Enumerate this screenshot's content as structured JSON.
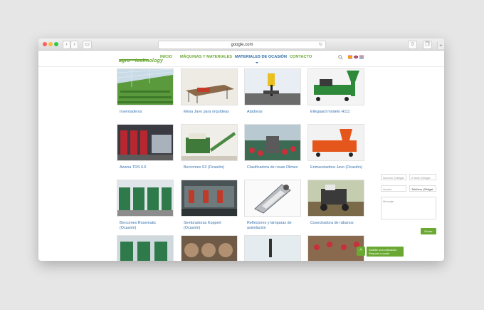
{
  "browser": {
    "url": "google.com",
    "nav_buttons": [
      "back-icon",
      "forward-icon",
      "sidebar-icon"
    ],
    "reload_icon": "reload-icon"
  },
  "site": {
    "logo_text": "agro · technology",
    "brand_color": "#6aa832",
    "active_color": "#2d6ca2",
    "nav": [
      {
        "label": "INICIO"
      },
      {
        "label": "MÁQUINAS Y MATERIALES"
      },
      {
        "label": "MATERIALES DE OCASIÓN"
      },
      {
        "label": "CONTACTO"
      }
    ],
    "active_nav": "MATERIALES DE OCASIÓN",
    "flags": [
      "spain-flag-icon",
      "uk-flag-icon",
      "netherlands-flag-icon"
    ]
  },
  "products": [
    {
      "caption": "Invernaderos",
      "image": "greenhouse"
    },
    {
      "caption": "Mesa Javo para orquídeas",
      "image": "table"
    },
    {
      "caption": "Atadoras",
      "image": "tying-machine"
    },
    {
      "caption": "Ellegaard modelo H111",
      "image": "green-machine"
    },
    {
      "caption": "Awena TRS 6.6",
      "image": "red-line"
    },
    {
      "caption": "Bercomex S3 (Ocasión)",
      "image": "conveyor"
    },
    {
      "caption": "Clasificadora de rosas Olimex",
      "image": "rose-grader"
    },
    {
      "caption": "Enmacetadora Javo (Ocasión)",
      "image": "orange-potter"
    },
    {
      "caption": "Bercomex Rosematic (Ocasión)",
      "image": "rosematic"
    },
    {
      "caption": "Sembradoras Koppert (Ocasión)",
      "image": "seeder"
    },
    {
      "caption": "Reflectores y lámparas de asimilación",
      "image": "lamp"
    },
    {
      "caption": "Cosechadora de rábanos",
      "image": "harvester"
    },
    {
      "caption": "",
      "image": "row4-a"
    },
    {
      "caption": "",
      "image": "row4-b"
    },
    {
      "caption": "",
      "image": "row4-c"
    },
    {
      "caption": "",
      "image": "row4-d"
    }
  ],
  "contact_form": {
    "name_placeholder": "Nombre (Obligat",
    "email_placeholder": "E-Mail (Obligat",
    "subject_placeholder": "Asunto",
    "phone_placeholder": "Teléfono (Obligat",
    "message_placeholder": "Mensaje",
    "send_label": "Enviar"
  },
  "quote": {
    "line1": "Solicite una cotización",
    "line2": "Request a quote"
  }
}
